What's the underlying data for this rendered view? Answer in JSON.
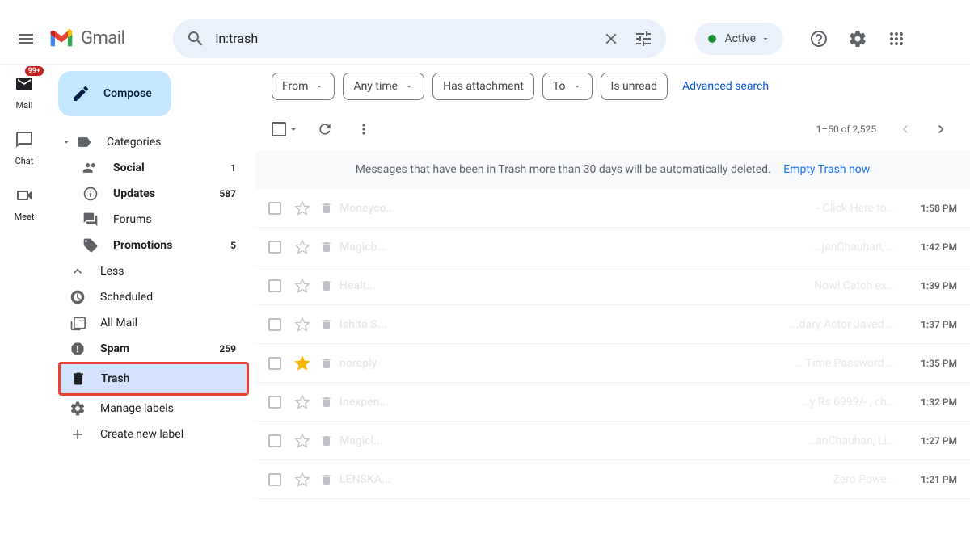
{
  "header": {
    "product": "Gmail",
    "search_value": "in:trash",
    "status_label": "Active",
    "badge": "99+"
  },
  "rail": {
    "mail": "Mail",
    "chat": "Chat",
    "meet": "Meet"
  },
  "compose": "Compose",
  "nav": {
    "categories": "Categories",
    "social": {
      "label": "Social",
      "count": "1"
    },
    "updates": {
      "label": "Updates",
      "count": "587"
    },
    "forums": {
      "label": "Forums"
    },
    "promotions": {
      "label": "Promotions",
      "count": "5"
    },
    "less": "Less",
    "scheduled": "Scheduled",
    "allmail": "All Mail",
    "spam": {
      "label": "Spam",
      "count": "259"
    },
    "trash": "Trash",
    "manage": "Manage labels",
    "create": "Create new label"
  },
  "filters": {
    "from": "From",
    "anytime": "Any time",
    "hasattach": "Has attachment",
    "to": "To",
    "isunread": "Is unread",
    "advanced": "Advanced search"
  },
  "pagination": "1–50 of 2,525",
  "notice": {
    "text": "Messages that have been in Trash more than 30 days will be automatically deleted.",
    "link": "Empty Trash now"
  },
  "emails": [
    {
      "sender": "Moneyco...",
      "subject": "- Click Here to...",
      "time": "1:58 PM",
      "starred": false
    },
    {
      "sender": "Magicb...",
      "subject": "...janChauhan, ...",
      "time": "1:42 PM",
      "starred": false
    },
    {
      "sender": "Healt...",
      "subject": "Now! Catch ex...",
      "time": "1:39 PM",
      "starred": false
    },
    {
      "sender": "Ishita S...",
      "subject": "...dary Actor Javed ...",
      "time": "1:37 PM",
      "starred": false
    },
    {
      "sender": "noreply",
      "subject": "...Time Password ...",
      "time": "1:35 PM",
      "starred": true
    },
    {
      "sender": "Inexpen...",
      "subject": "...y Rs 6999/- , ch...",
      "time": "1:32 PM",
      "starred": false
    },
    {
      "sender": "Magicl...",
      "subject": "...anChauhan, Li...",
      "time": "1:27 PM",
      "starred": false
    },
    {
      "sender": "LENSKA...",
      "subject": "Zero Powe...",
      "time": "1:21 PM",
      "starred": false
    }
  ]
}
